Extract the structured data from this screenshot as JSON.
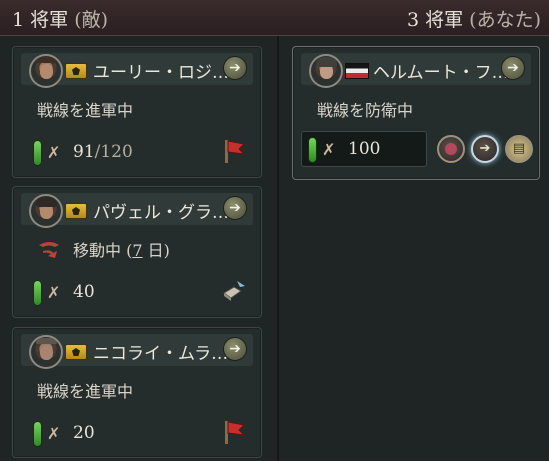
{
  "header": {
    "left_count": "1",
    "left_label": "将軍",
    "left_side": "(敵)",
    "right_count": "3",
    "right_label": "将軍",
    "right_side": "(あなた)"
  },
  "enemy_generals": [
    {
      "name": "ユーリー・ロジ…",
      "status": "戦線を進軍中",
      "strength": "91",
      "strength_max": "/120",
      "order_icon": "red-flag-icon"
    },
    {
      "name": "パヴェル・グラ…",
      "status_prefix": "移動中 (",
      "status_days": "7",
      "status_suffix": " 日)",
      "strength": "40",
      "order_icon": "supply-icon"
    },
    {
      "name": "ニコライ・ムラ…",
      "status": "戦線を進軍中",
      "strength": "20",
      "order_icon": "red-flag-icon"
    }
  ],
  "own_generals": [
    {
      "name": "ヘルムート・フ…",
      "status": "戦線を防衛中",
      "strength": "100",
      "abilities": [
        "portrait-ability-icon",
        "advance-ability-icon",
        "document-ability-icon"
      ]
    }
  ],
  "colors": {
    "header_bg": "#3a2b2c",
    "card_bg": "#252d2c",
    "strength_bar": "#4fb33a",
    "rank_gold": "#d4a82b",
    "flag": [
      "#151515",
      "#eeeeee",
      "#c9292b"
    ]
  }
}
